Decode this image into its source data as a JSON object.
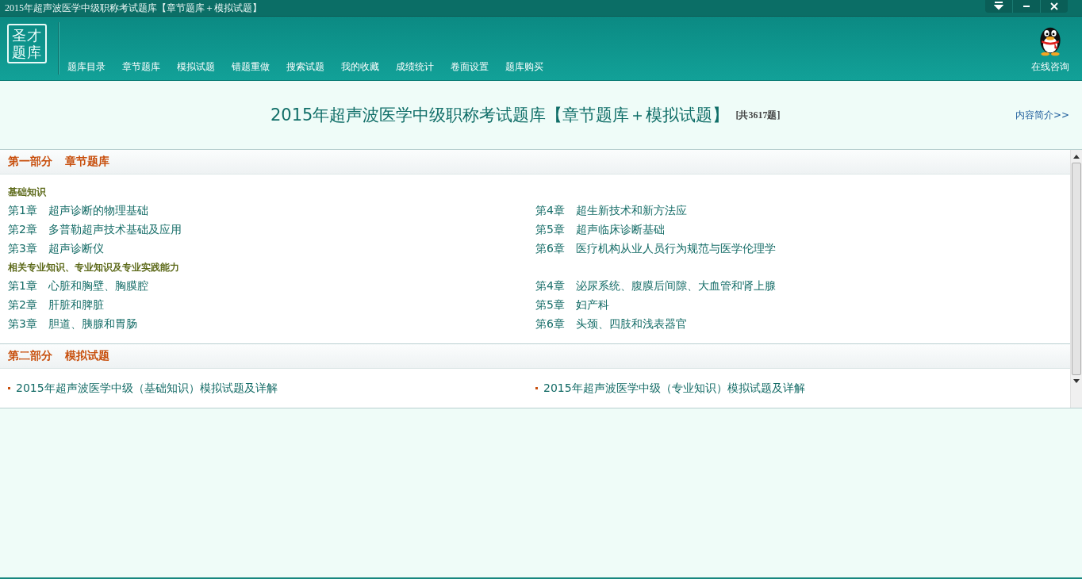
{
  "window": {
    "title": "2015年超声波医学中级职称考试题库【章节题库＋模拟试题】",
    "controls": [
      {
        "kind": "dropdown"
      },
      {
        "kind": "minimize"
      },
      {
        "kind": "close"
      }
    ]
  },
  "header": {
    "logo": [
      "圣才",
      "题库"
    ],
    "nav": [
      {
        "label": "题库目录"
      },
      {
        "label": "章节题库"
      },
      {
        "label": "模拟试题"
      },
      {
        "label": "错题重做"
      },
      {
        "label": "搜索试题"
      },
      {
        "label": "我的收藏"
      },
      {
        "label": "成绩统计"
      },
      {
        "label": "卷面设置"
      },
      {
        "label": "题库购买"
      }
    ],
    "consult": "在线咨询"
  },
  "main": {
    "title": "2015年超声波医学中级职称考试题库【章节题库＋模拟试题】",
    "count": "[共3617题]",
    "intro_link": "内容简介>>"
  },
  "sections": [
    {
      "part": "第一部分",
      "name": "章节题库",
      "groups": [
        {
          "heading": "基础知识",
          "items": [
            {
              "chapter": "第1章",
              "title": "超声诊断的物理基础"
            },
            {
              "chapter": "第4章",
              "title": "超生新技术和新方法应"
            },
            {
              "chapter": "第2章",
              "title": "多普勒超声技术基础及应用"
            },
            {
              "chapter": "第5章",
              "title": "超声临床诊断基础"
            },
            {
              "chapter": "第3章",
              "title": "超声诊断仪"
            },
            {
              "chapter": "第6章",
              "title": "医疗机构从业人员行为规范与医学伦理学"
            }
          ]
        },
        {
          "heading": "相关专业知识、专业知识及专业实践能力",
          "items": [
            {
              "chapter": "第1章",
              "title": "心脏和胸壁、胸膜腔"
            },
            {
              "chapter": "第4章",
              "title": "泌尿系统、腹膜后间隙、大血管和肾上腺"
            },
            {
              "chapter": "第2章",
              "title": "肝脏和脾脏"
            },
            {
              "chapter": "第5章",
              "title": "妇产科"
            },
            {
              "chapter": "第3章",
              "title": "胆道、胰腺和胃肠"
            },
            {
              "chapter": "第6章",
              "title": "头颈、四肢和浅表器官"
            }
          ]
        }
      ]
    },
    {
      "part": "第二部分",
      "name": "模拟试题",
      "links": [
        "2015年超声波医学中级（基础知识）模拟试题及详解",
        "2015年超声波医学中级（专业知识）模拟试题及详解"
      ]
    }
  ]
}
